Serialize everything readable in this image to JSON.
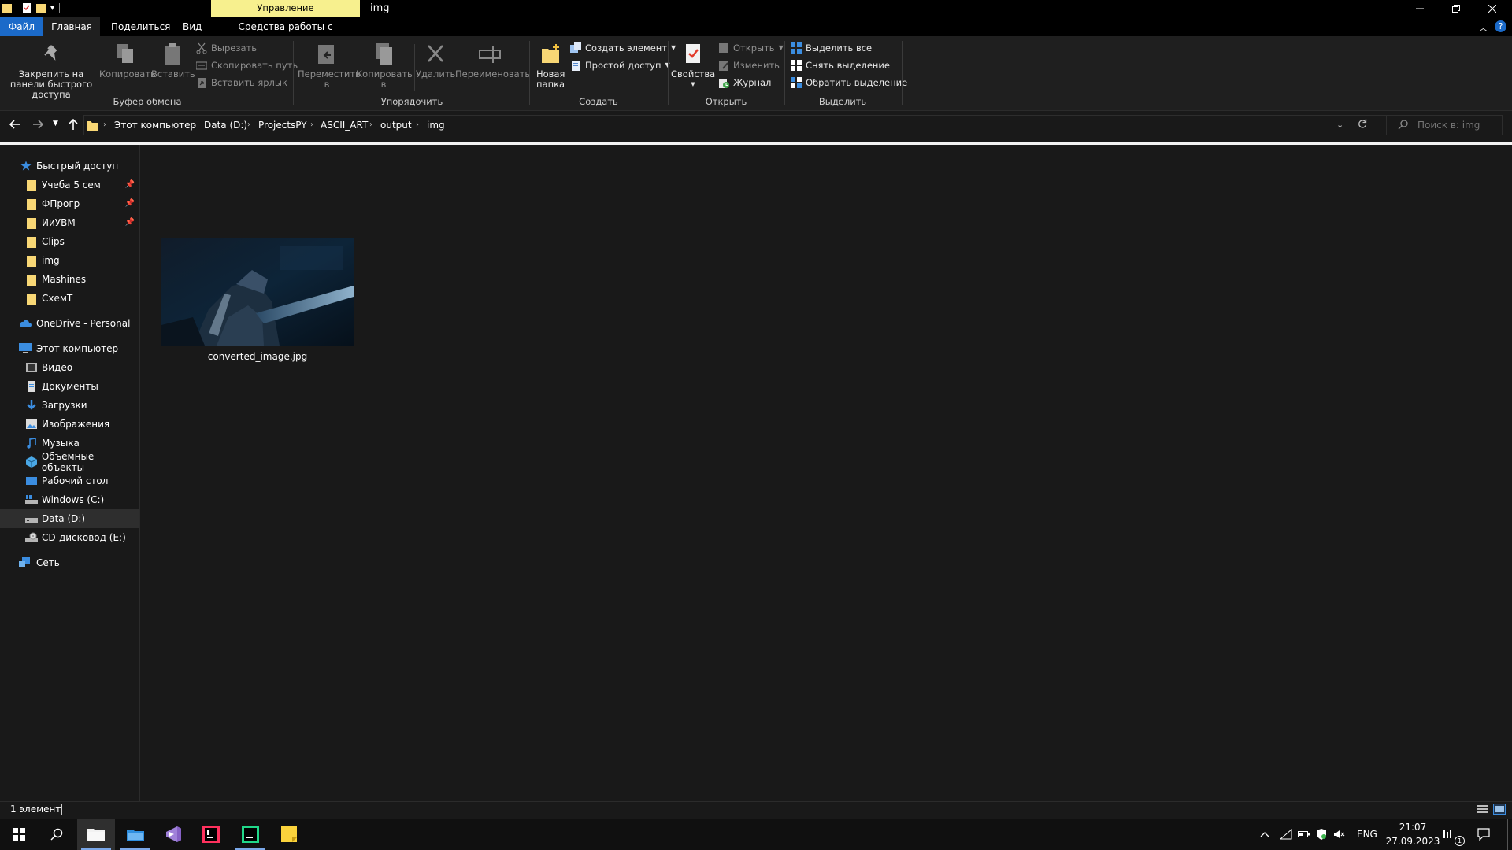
{
  "window": {
    "title": "img",
    "context_tab": "Управление"
  },
  "ribbon_tabs": [
    "Файл",
    "Главная",
    "Поделиться",
    "Вид",
    "Средства работы с рисунками"
  ],
  "ribbon": {
    "clipboard": {
      "pin": "Закрепить на панели быстрого доступа",
      "copy": "Копировать",
      "paste": "Вставить",
      "cut": "Вырезать",
      "copy_path": "Скопировать путь",
      "paste_shortcut": "Вставить ярлык",
      "label": "Буфер обмена"
    },
    "organize": {
      "move": "Переместить в",
      "copy_to": "Копировать в",
      "delete": "Удалить",
      "rename": "Переименовать",
      "label": "Упорядочить"
    },
    "create": {
      "new_folder": "Новая папка",
      "new_item": "Создать элемент",
      "easy_access": "Простой доступ",
      "label": "Создать"
    },
    "open": {
      "properties": "Свойства",
      "open": "Открыть",
      "edit": "Изменить",
      "history": "Журнал",
      "label": "Открыть"
    },
    "select": {
      "select_all": "Выделить все",
      "select_none": "Снять выделение",
      "invert": "Обратить выделение",
      "label": "Выделить"
    }
  },
  "address": {
    "crumbs": [
      "Этот компьютер",
      "Data (D:)",
      "ProjectsPY",
      "ASCII_ART",
      "output",
      "img"
    ],
    "search_placeholder": "Поиск в: img"
  },
  "sidebar": {
    "quick_access": "Быстрый доступ",
    "quick_items": [
      "Учеба 5 сем",
      "ФПрогр",
      "ИиУВМ",
      "Clips",
      "img",
      "Mashines",
      "СхемТ"
    ],
    "onedrive": "OneDrive - Personal",
    "this_pc": "Этот компьютер",
    "pc_items": [
      "Видео",
      "Документы",
      "Загрузки",
      "Изображения",
      "Музыка",
      "Объемные объекты",
      "Рабочий стол",
      "Windows (C:)",
      "Data (D:)",
      "CD-дисковод (E:)"
    ],
    "network": "Сеть"
  },
  "files": [
    {
      "name": "converted_image.jpg"
    }
  ],
  "status": {
    "count": "1 элемент"
  },
  "tray": {
    "lang": "ENG",
    "time": "21:07",
    "date": "27.09.2023",
    "notif_count": "1"
  },
  "colors": {
    "accent": "#1b6ac9",
    "context_tab": "#f7f08e",
    "folder": "#f8d775"
  }
}
